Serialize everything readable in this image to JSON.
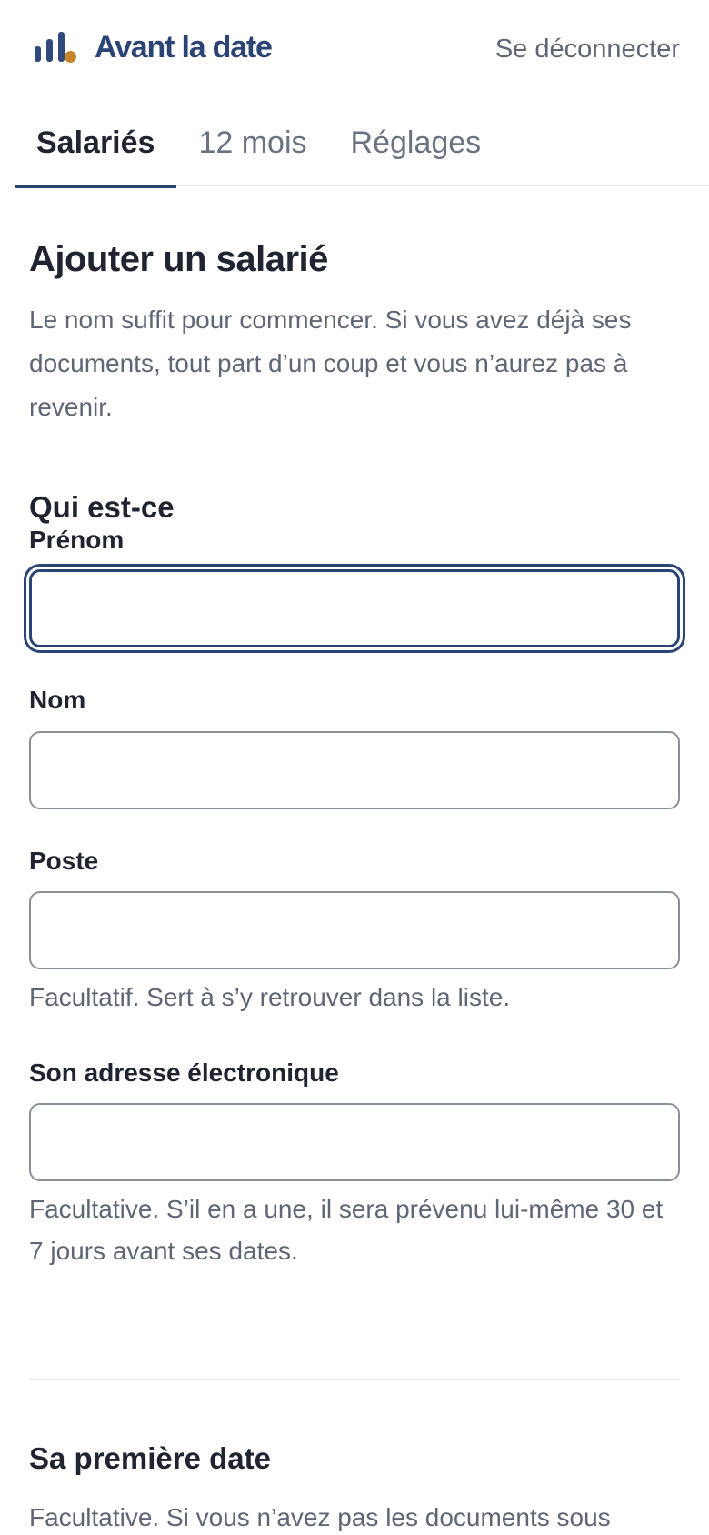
{
  "header": {
    "brand_name": "Avant la date",
    "logout_label": "Se déconnecter",
    "accent_color": "#2c4474",
    "logo_dot_color": "#c8862a"
  },
  "tabs": [
    {
      "label": "Salariés",
      "active": true
    },
    {
      "label": "12 mois",
      "active": false
    },
    {
      "label": "Réglages",
      "active": false
    }
  ],
  "main": {
    "title": "Ajouter un salarié",
    "intro": "Le nom suffit pour commencer. Si vous avez déjà ses documents, tout part d’un coup et vous n’aurez pas à revenir.",
    "section_who": {
      "title": "Qui est-ce",
      "first_name": {
        "label": "Prénom",
        "value": ""
      },
      "last_name": {
        "label": "Nom",
        "value": ""
      },
      "position": {
        "label": "Poste",
        "value": "",
        "help": "Facultatif. Sert à s’y retrouver dans la liste."
      },
      "email": {
        "label": "Son adresse électronique",
        "value": "",
        "help": "Facultative. S’il en a une, il sera prévenu lui-même 30 et 7 jours avant ses dates."
      }
    },
    "section_first_date": {
      "title": "Sa première date",
      "help": "Facultative. Si vous n’avez pas les documents sous"
    }
  }
}
